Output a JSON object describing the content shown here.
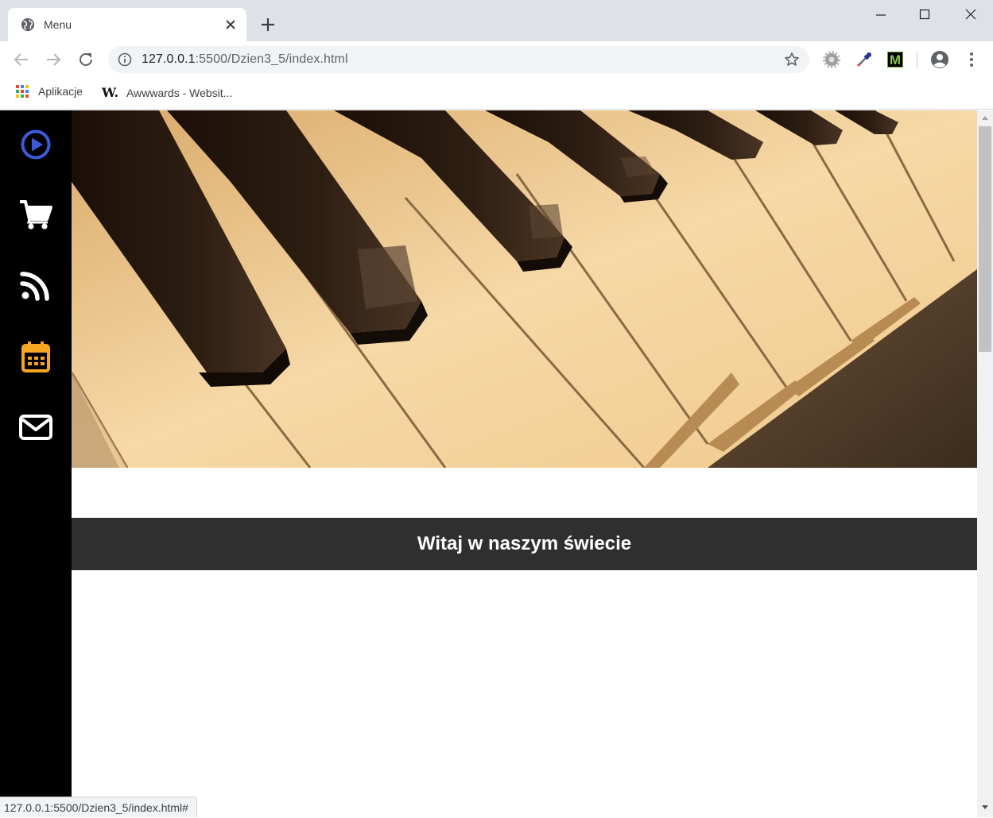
{
  "browser": {
    "tab_title": "Menu",
    "url_host": "127.0.0.1",
    "url_rest": ":5500/Dzien3_5/index.html",
    "bookmarks": [
      {
        "label": "Aplikacje",
        "icon": "apps-grid-icon"
      },
      {
        "label": "Awwwards - Websit...",
        "icon": "awwwards-w-icon",
        "logo": "W."
      }
    ],
    "extension_m_label": "M",
    "status_url": "127.0.0.1:5500/Dzien3_5/index.html#"
  },
  "sidebar": {
    "items": [
      {
        "icon": "play-circle-icon",
        "color": "#3b5bdb"
      },
      {
        "icon": "shopping-cart-icon",
        "color": "#ffffff"
      },
      {
        "icon": "rss-feed-icon",
        "color": "#ffffff"
      },
      {
        "icon": "calendar-icon",
        "color": "#f5a623"
      },
      {
        "icon": "envelope-icon",
        "color": "#ffffff"
      }
    ]
  },
  "main": {
    "hero_image": "piano-keys-photo",
    "banner_title": "Witaj w naszym świecie"
  },
  "colors": {
    "sidebar_bg": "#000000",
    "banner_bg": "#2f2f2f",
    "hero_tone": "#e8c48a"
  }
}
